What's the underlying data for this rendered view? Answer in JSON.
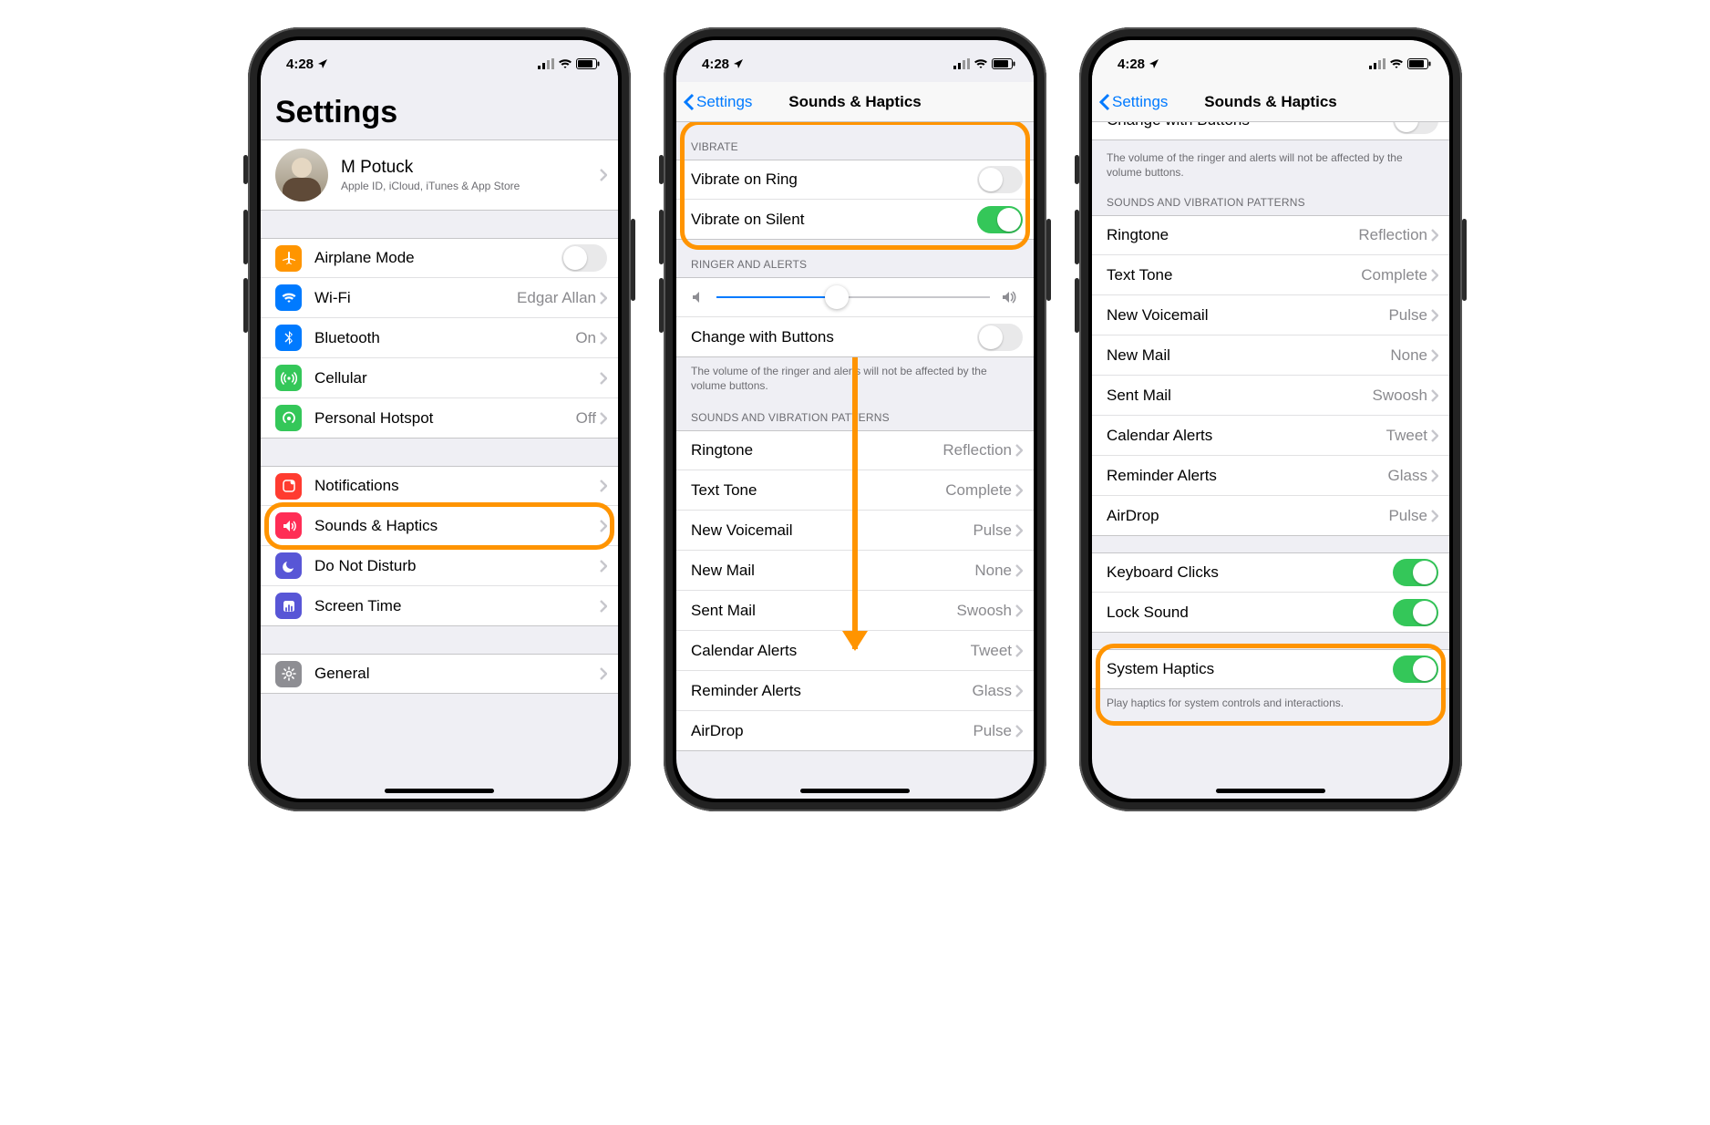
{
  "status": {
    "time": "4:28",
    "carrier_signal": true,
    "wifi": true,
    "battery": true,
    "location_arrow": true
  },
  "phone1": {
    "big_title": "Settings",
    "account": {
      "name": "M Potuck",
      "subtitle": "Apple ID, iCloud, iTunes & App Store"
    },
    "group_a": [
      {
        "icon": "airplane",
        "color": "#ff9500",
        "label": "Airplane Mode",
        "toggle": false
      },
      {
        "icon": "wifi",
        "color": "#007aff",
        "label": "Wi-Fi",
        "detail": "Edgar Allan"
      },
      {
        "icon": "bluetooth",
        "color": "#007aff",
        "label": "Bluetooth",
        "detail": "On"
      },
      {
        "icon": "cellular",
        "color": "#34c759",
        "label": "Cellular",
        "detail": ""
      },
      {
        "icon": "hotspot",
        "color": "#34c759",
        "label": "Personal Hotspot",
        "detail": "Off"
      }
    ],
    "group_b": [
      {
        "icon": "notifications",
        "color": "#ff3b30",
        "label": "Notifications"
      },
      {
        "icon": "sounds",
        "color": "#ff2d55",
        "label": "Sounds & Haptics",
        "highlight": true
      },
      {
        "icon": "dnd",
        "color": "#5856d6",
        "label": "Do Not Disturb"
      },
      {
        "icon": "screentime",
        "color": "#5856d6",
        "label": "Screen Time"
      }
    ],
    "group_c": [
      {
        "icon": "general",
        "color": "#8e8e93",
        "label": "General"
      }
    ]
  },
  "phone2": {
    "back": "Settings",
    "title": "Sounds & Haptics",
    "vibrate_header": "VIBRATE",
    "vibrate": [
      {
        "label": "Vibrate on Ring",
        "on": false
      },
      {
        "label": "Vibrate on Silent",
        "on": true
      }
    ],
    "ringer_header": "RINGER AND ALERTS",
    "change_with_buttons": {
      "label": "Change with Buttons",
      "on": false
    },
    "ringer_footer": "The volume of the ringer and alerts will not be affected by the volume buttons.",
    "patterns_header": "SOUNDS AND VIBRATION PATTERNS",
    "patterns": [
      {
        "label": "Ringtone",
        "detail": "Reflection"
      },
      {
        "label": "Text Tone",
        "detail": "Complete"
      },
      {
        "label": "New Voicemail",
        "detail": "Pulse"
      },
      {
        "label": "New Mail",
        "detail": "None"
      },
      {
        "label": "Sent Mail",
        "detail": "Swoosh"
      },
      {
        "label": "Calendar Alerts",
        "detail": "Tweet"
      },
      {
        "label": "Reminder Alerts",
        "detail": "Glass"
      },
      {
        "label": "AirDrop",
        "detail": "Pulse"
      }
    ]
  },
  "phone3": {
    "back": "Settings",
    "title": "Sounds & Haptics",
    "partial_change": {
      "label": "Change with Buttons"
    },
    "ringer_footer": "The volume of the ringer and alerts will not be affected by the volume buttons.",
    "patterns_header": "SOUNDS AND VIBRATION PATTERNS",
    "patterns": [
      {
        "label": "Ringtone",
        "detail": "Reflection"
      },
      {
        "label": "Text Tone",
        "detail": "Complete"
      },
      {
        "label": "New Voicemail",
        "detail": "Pulse"
      },
      {
        "label": "New Mail",
        "detail": "None"
      },
      {
        "label": "Sent Mail",
        "detail": "Swoosh"
      },
      {
        "label": "Calendar Alerts",
        "detail": "Tweet"
      },
      {
        "label": "Reminder Alerts",
        "detail": "Glass"
      },
      {
        "label": "AirDrop",
        "detail": "Pulse"
      }
    ],
    "switches": [
      {
        "label": "Keyboard Clicks",
        "on": true
      },
      {
        "label": "Lock Sound",
        "on": true
      }
    ],
    "system_haptics": {
      "label": "System Haptics",
      "on": true,
      "highlight": true
    },
    "haptics_footer": "Play haptics for system controls and interactions."
  }
}
